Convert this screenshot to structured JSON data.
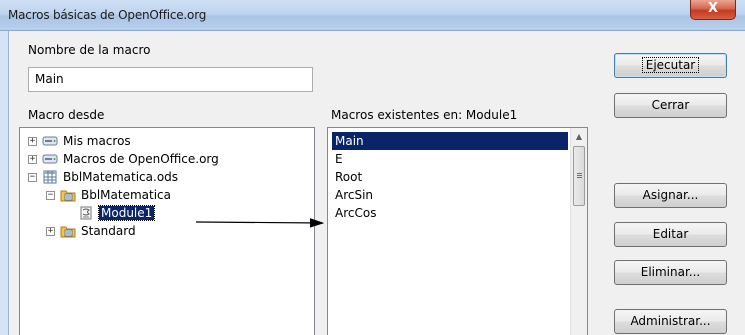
{
  "window": {
    "title": "Macros básicas de OpenOffice.org",
    "close_glyph": "X"
  },
  "labels": {
    "macro_name": "Nombre de la macro",
    "macro_from": "Macro desde",
    "existing_macros": "Macros existentes en: Module1"
  },
  "macro_name_input": {
    "value": "Main"
  },
  "tree": {
    "items": [
      {
        "label": "Mis macros",
        "icon": "drive-icon",
        "expander": "+"
      },
      {
        "label": "Macros de OpenOffice.org",
        "icon": "drive-icon",
        "expander": "+"
      },
      {
        "label": "BblMatematica.ods",
        "icon": "spreadsheet-icon",
        "expander": "−"
      },
      {
        "label": "BblMatematica",
        "icon": "library-icon",
        "expander": "−"
      },
      {
        "label": "Module1",
        "icon": "module-icon",
        "selected": true
      },
      {
        "label": "Standard",
        "icon": "library-icon",
        "expander": "+"
      }
    ]
  },
  "macros_list": {
    "items": [
      "Main",
      "E",
      "Root",
      "ArcSin",
      "ArcCos"
    ],
    "selected": "Main"
  },
  "buttons": {
    "run": "Ejecutar",
    "close": "Cerrar",
    "assign": "Asignar...",
    "edit": "Editar",
    "delete": "Eliminar...",
    "manage": "Administrar..."
  },
  "colors": {
    "selection": "#0a246a",
    "title_bar": "#bed3ee",
    "close_button": "#c53a20"
  }
}
